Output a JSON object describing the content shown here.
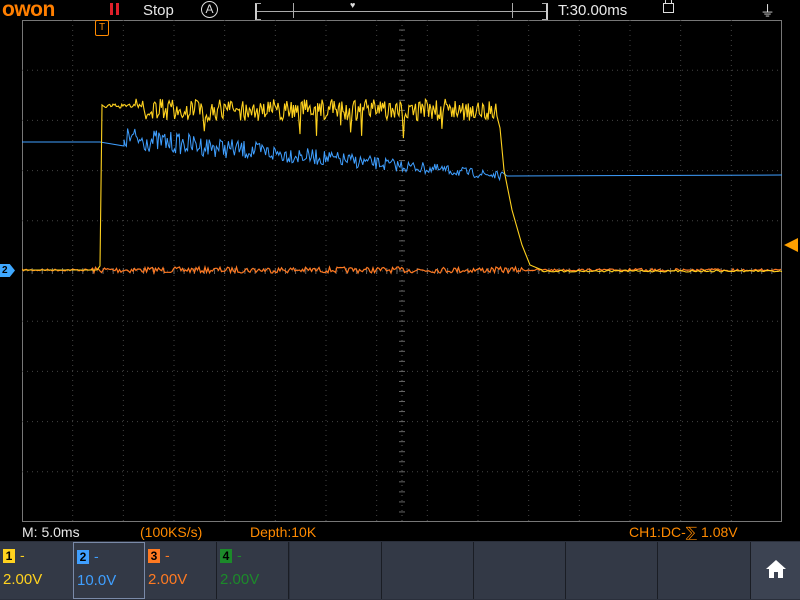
{
  "header": {
    "brand": "OWON",
    "run_state": "Stop",
    "acquire_icon": "A",
    "time_offset": "T:30.00ms",
    "trigger_marker": "T"
  },
  "scope": {
    "channel_marker": "2",
    "traces": [
      {
        "name": "CH1",
        "color": "#ffd21f"
      },
      {
        "name": "CH2",
        "color": "#3f9fff"
      },
      {
        "name": "CH3",
        "color": "#ff7a22"
      }
    ]
  },
  "info": {
    "timebase": "M: 5.0ms",
    "sample_rate": "(100KS/s)",
    "depth": "Depth:10K",
    "trigger": "CH1:DC-⅀ 1.08V"
  },
  "channels": [
    {
      "num": "1",
      "coupling": "-",
      "scale": "2.00V",
      "color": "#ffd21f"
    },
    {
      "num": "2",
      "coupling": "-",
      "scale": "10.0V",
      "color": "#3f9fff"
    },
    {
      "num": "3",
      "coupling": "-",
      "scale": "2.00V",
      "color": "#ff7a22"
    },
    {
      "num": "4",
      "coupling": "-",
      "scale": "2.00V",
      "color": "#1c8a2a"
    }
  ],
  "icons": {
    "home": "home-icon",
    "lock": "lock-icon",
    "usb": "usb-icon"
  }
}
